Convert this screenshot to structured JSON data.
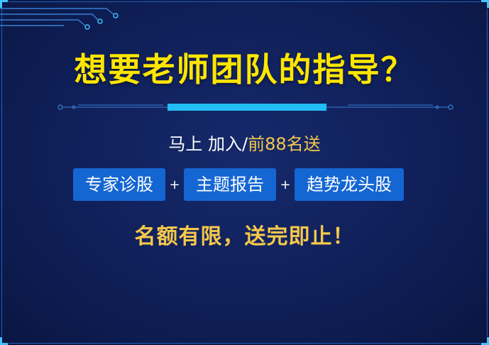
{
  "headline": "想要老师团队的指导？",
  "subtitle": {
    "prefix": "马上 加入/",
    "highlight": "前88名送"
  },
  "benefits": [
    {
      "label": "专家诊股"
    },
    {
      "label": "主题报告"
    },
    {
      "label": "趋势龙头股"
    }
  ],
  "separator": "+",
  "notice": "名额有限，送完即止！",
  "colors": {
    "background": "#0f1f58",
    "headline": "#ffe600",
    "accent_gold": "#f5c84a",
    "tag_bg": "#1466d3",
    "divider_cyan": "#22bdf5",
    "frame": "#1e5fb8"
  }
}
